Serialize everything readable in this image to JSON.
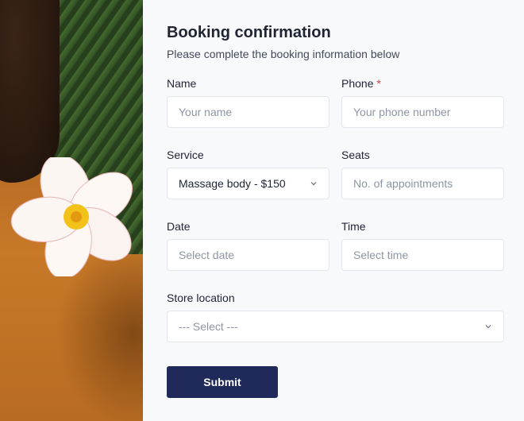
{
  "form": {
    "title": "Booking confirmation",
    "subtitle": "Please complete the booking information below",
    "name": {
      "label": "Name",
      "placeholder": "Your name"
    },
    "phone": {
      "label": "Phone",
      "required_mark": "*",
      "placeholder": "Your phone number"
    },
    "service": {
      "label": "Service",
      "value": "Massage body - $150",
      "icon": "chevron-down-icon"
    },
    "seats": {
      "label": "Seats",
      "placeholder": "No. of appointments"
    },
    "date": {
      "label": "Date",
      "placeholder": "Select date"
    },
    "time": {
      "label": "Time",
      "placeholder": "Select time"
    },
    "location": {
      "label": "Store location",
      "value": "--- Select ---",
      "icon": "chevron-down-icon"
    },
    "submit_label": "Submit"
  },
  "colors": {
    "accent": "#1f2a5a",
    "required": "#e53935",
    "panel_bg": "#f8f9fb"
  }
}
